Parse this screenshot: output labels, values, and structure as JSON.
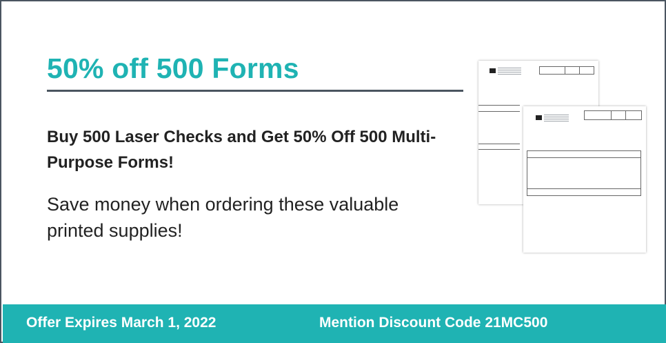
{
  "promo": {
    "headline": "50% off 500 Forms",
    "subhead": "Buy 500 Laser Checks and Get 50% Off 500 Multi-Purpose Forms!",
    "body": "Save money when ordering these valuable printed supplies!"
  },
  "footer": {
    "expiry": "Offer Expires March 1, 2022",
    "discount": "Mention Discount Code 21MC500"
  },
  "colors": {
    "accent": "#1fb3b3",
    "border": "#4a5560",
    "text": "#222222"
  },
  "image": {
    "icon": "multi-purpose-forms-image"
  }
}
